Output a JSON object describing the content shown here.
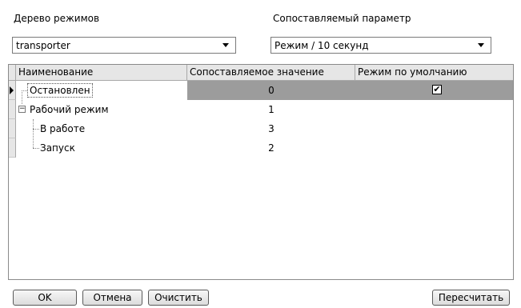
{
  "top": {
    "tree_label": "Дерево режимов",
    "tree_value": "transporter",
    "param_label": "Сопоставляемый параметр",
    "param_value": "Режим / 10 секунд"
  },
  "grid": {
    "columns": [
      "Наименование",
      "Сопоставляемое значение",
      "Режим по умолчанию"
    ],
    "rows": [
      {
        "name": "Остановлен",
        "value": "0",
        "default": true,
        "selected": true
      },
      {
        "name": "Рабочий режим",
        "value": "1",
        "default": false,
        "expander": "−"
      },
      {
        "name": "В работе",
        "value": "3",
        "default": false
      },
      {
        "name": "Запуск",
        "value": "2",
        "default": false
      }
    ]
  },
  "buttons": {
    "ok": "OK",
    "cancel": "Отмена",
    "clear": "Очистить",
    "recalc": "Пересчитать"
  },
  "checkmark": "✔"
}
